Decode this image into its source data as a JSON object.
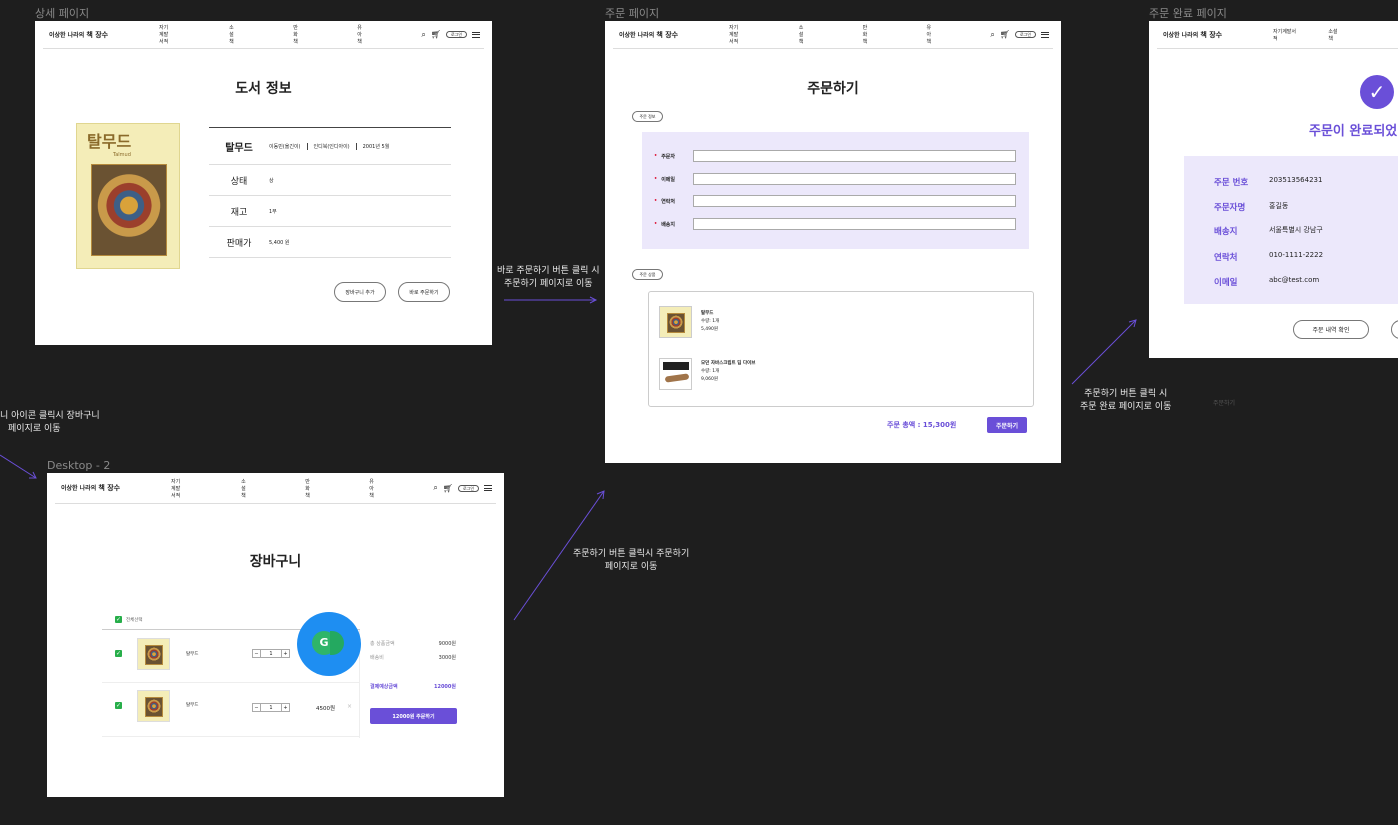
{
  "frames": {
    "detail_label": "상세 페이지",
    "order_label": "주문 페이지",
    "complete_label": "주문 완료 페이지",
    "cart_label": "Desktop - 2"
  },
  "nav": {
    "logo_a": "이상한 나라의",
    "logo_b": "책 장수",
    "menu": [
      "자기계발서적",
      "소설책",
      "만화책",
      "유아책"
    ],
    "login": "로그인",
    "icons": [
      "search-icon",
      "cart-icon",
      "menu-icon"
    ]
  },
  "detail": {
    "title": "도서 정보",
    "book_cover_title": "탈무드",
    "book_cover_sub": "Talmud",
    "name": "탈무드",
    "author": "이동민(옮긴이)",
    "publisher": "인디북(인디아이)",
    "date": "2001년 5월",
    "rows": [
      {
        "key": "상태",
        "val": "상"
      },
      {
        "key": "재고",
        "val": "1부"
      },
      {
        "key": "판매가",
        "val": "5,400 원"
      }
    ],
    "cart_btn": "장바구니 추가",
    "order_btn": "바로 주문하기"
  },
  "order": {
    "title": "주문하기",
    "info_tag": "주문 정보",
    "fields": [
      "주문자",
      "이메일",
      "연락처",
      "배송지"
    ],
    "products_tag": "주문 상품",
    "items": [
      {
        "name": "탈무드",
        "qty": "수량: 1개",
        "price": "5,490원"
      },
      {
        "name": "모던 자바스크립트 딥 다이브",
        "qty": "수량: 1개",
        "price": "9,060원"
      }
    ],
    "total": "주문 총액 : 15,300원",
    "submit": "주문하기"
  },
  "complete": {
    "title": "주문이 완료되었",
    "rows": [
      {
        "key": "주문 번호",
        "val": "203513564231"
      },
      {
        "key": "주문자명",
        "val": "홍길동"
      },
      {
        "key": "배송지",
        "val": "서울특별시 강남구"
      },
      {
        "key": "연락처",
        "val": "010-1111-2222"
      },
      {
        "key": "이메일",
        "val": "abc@test.com"
      }
    ],
    "history_btn": "주문 내역 확인"
  },
  "cart": {
    "title": "장바구니",
    "select_all": "전체선택",
    "items": [
      {
        "name": "탈무드",
        "qty": "1"
      },
      {
        "name": "탈무드",
        "qty": "1",
        "price": "4500원"
      }
    ],
    "summary": {
      "total_label": "총 상품금액",
      "total": "9000원",
      "ship_label": "배송비",
      "ship": "3000원",
      "pay_label": "결제예상금액",
      "pay": "12000원",
      "button": "12000원 주문하기"
    },
    "grammarly": "G"
  },
  "annotations": {
    "a1": "바로 주문하기 버튼 클릭 시\n주문하기 페이지로 이동",
    "a2": "주문하기 버튼 클릭 시\n주문 완료 페이지로 이동",
    "a3": "주문하기 버튼 클릭시 주문하기\n페이지로 이동",
    "a4": "니 아이콘 클릭시 장바구니\n페이지로 이동",
    "faint": "주문하기"
  },
  "colors": {
    "accent": "#6a4fd8",
    "lavender": "#ece8fb",
    "check": "#27ae4a",
    "grammarly_bg": "#1e8ef2"
  }
}
